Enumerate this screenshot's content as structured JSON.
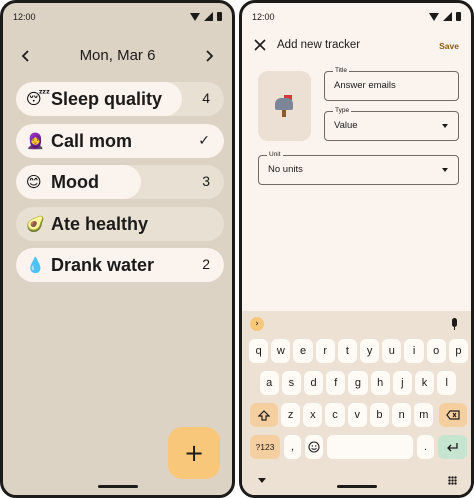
{
  "status_bar": {
    "time": "12:00"
  },
  "day_view": {
    "date_label": "Mon, Mar 6",
    "prev_icon": "chevron-left-icon",
    "next_icon": "chevron-right-icon",
    "trackers": [
      {
        "emoji": "😴",
        "label": "Sleep quality",
        "value": "4",
        "fill": 0.8
      },
      {
        "emoji": "🧕",
        "label": "Call mom",
        "value": "✓",
        "fill": 1.0
      },
      {
        "emoji": "😊",
        "label": "Mood",
        "value": "3",
        "fill": 0.6
      },
      {
        "emoji": "🥑",
        "label": "Ate healthy",
        "value": "",
        "fill": 0.0
      },
      {
        "emoji": "💧",
        "label": "Drank water",
        "value": "2",
        "fill": 1.0
      }
    ],
    "fab_icon": "plus-icon",
    "fab_label": "+"
  },
  "new_tracker": {
    "close_icon": "close-icon",
    "title": "Add new tracker",
    "save_label": "Save",
    "emoji_icon": "mailbox-icon",
    "fields": {
      "title": {
        "label": "Title",
        "value": "Answer emails"
      },
      "type": {
        "label": "Type",
        "value": "Value"
      },
      "unit": {
        "label": "Unit",
        "value": "No units"
      }
    }
  },
  "keyboard": {
    "row1": [
      "q",
      "w",
      "e",
      "r",
      "t",
      "y",
      "u",
      "i",
      "o",
      "p"
    ],
    "row2": [
      "a",
      "s",
      "d",
      "f",
      "g",
      "h",
      "j",
      "k",
      "l"
    ],
    "row3": [
      "z",
      "x",
      "c",
      "v",
      "b",
      "n",
      "m"
    ],
    "symbols_label": "?123",
    "comma": ",",
    "period": ".",
    "shift_icon": "shift-icon",
    "backspace_icon": "backspace-icon",
    "emoji_icon": "emoji-smile-icon",
    "enter_icon": "enter-icon",
    "mic_icon": "mic-icon",
    "suggest_icon": "chevron-right-icon",
    "suggest_label": "›"
  },
  "colors": {
    "left_background": "#dcd3c4",
    "right_background": "#fbf3ee",
    "accent": "#f8c77a",
    "enter_key": "#c6e5d0"
  }
}
